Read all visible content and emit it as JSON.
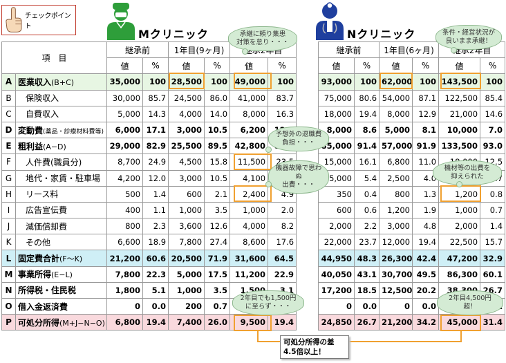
{
  "checkpoint": {
    "label": "チェックポイント"
  },
  "clinics": {
    "m": {
      "title": "Mクリニック"
    },
    "n": {
      "title": "Nクリニック"
    }
  },
  "table": {
    "item_header": "項　目",
    "period_headers": [
      "継承前",
      "1年目(9ヶ月)",
      "継承2年目"
    ],
    "n_period_headers": [
      "継承前",
      "1年目(6ヶ月)",
      "継承2年目"
    ],
    "sub_headers": [
      "値",
      "%"
    ],
    "rows": [
      {
        "letter": "A",
        "label": "医業収入",
        "suffix": "(B+C)",
        "m": [
          "35,000",
          "100",
          "28,500",
          "100",
          "49,000",
          "100"
        ],
        "n": [
          "93,000",
          "100",
          "62,000",
          "100",
          "143,500",
          "100"
        ]
      },
      {
        "letter": "B",
        "label": "保険収入",
        "suffix": "",
        "m": [
          "30,000",
          "85.7",
          "24,500",
          "86.0",
          "41,000",
          "83.7"
        ],
        "n": [
          "75,000",
          "80.6",
          "54,000",
          "87.1",
          "122,500",
          "85.4"
        ]
      },
      {
        "letter": "C",
        "label": "自費収入",
        "suffix": "",
        "m": [
          "5,000",
          "14.3",
          "4,000",
          "14.0",
          "8,000",
          "16.3"
        ],
        "n": [
          "18,000",
          "19.4",
          "8,000",
          "12.9",
          "21,000",
          "14.6"
        ]
      },
      {
        "letter": "D",
        "label": "変動費",
        "suffix": "(薬品・診療材料費等)",
        "m": [
          "6,000",
          "17.1",
          "3,000",
          "10.5",
          "6,200",
          "12.6"
        ],
        "n": [
          "8,000",
          "8.6",
          "5,000",
          "8.1",
          "10,000",
          "7.0"
        ]
      },
      {
        "letter": "E",
        "label": "粗利益",
        "suffix": "(A−D)",
        "m": [
          "29,000",
          "82.9",
          "25,500",
          "89.5",
          "42,800",
          "87.3"
        ],
        "n": [
          "85,000",
          "91.4",
          "57,000",
          "91.9",
          "133,500",
          "93.0"
        ]
      },
      {
        "letter": "F",
        "label": "人件費(職員分)",
        "suffix": "",
        "m": [
          "8,700",
          "24.9",
          "4,500",
          "15.8",
          "11,500",
          "23.5"
        ],
        "n": [
          "15,000",
          "16.1",
          "6,800",
          "11.0",
          "18,000",
          "12.5"
        ]
      },
      {
        "letter": "G",
        "label": "地代・家賃・駐車場",
        "suffix": "",
        "m": [
          "4,200",
          "12.0",
          "3,000",
          "10.5",
          "4,100",
          "8.4"
        ],
        "n": [
          "5,000",
          "5.4",
          "2,500",
          "4.0",
          "2,500",
          "1.7"
        ]
      },
      {
        "letter": "H",
        "label": "リース料",
        "suffix": "",
        "m": [
          "500",
          "1.4",
          "600",
          "2.1",
          "2,400",
          "4.9"
        ],
        "n": [
          "350",
          "0.4",
          "800",
          "1.3",
          "1,200",
          "0.8"
        ]
      },
      {
        "letter": "I",
        "label": "広告宣伝費",
        "suffix": "",
        "m": [
          "400",
          "1.1",
          "1,000",
          "3.5",
          "1,000",
          "2.0"
        ],
        "n": [
          "600",
          "0.6",
          "1,200",
          "1.9",
          "1,000",
          "0.7"
        ]
      },
      {
        "letter": "J",
        "label": "減価償却費",
        "suffix": "",
        "m": [
          "800",
          "2.3",
          "3,600",
          "12.6",
          "4,000",
          "8.2"
        ],
        "n": [
          "2,000",
          "2.2",
          "3,000",
          "4.8",
          "2,000",
          "1.4"
        ]
      },
      {
        "letter": "K",
        "label": "その他",
        "suffix": "",
        "m": [
          "6,600",
          "18.9",
          "7,800",
          "27.4",
          "8,600",
          "17.6"
        ],
        "n": [
          "22,000",
          "23.7",
          "12,000",
          "19.4",
          "22,500",
          "15.7"
        ]
      },
      {
        "letter": "L",
        "label": "固定費合計",
        "suffix": "(F〜K)",
        "m": [
          "21,200",
          "60.6",
          "20,500",
          "71.9",
          "31,600",
          "64.5"
        ],
        "n": [
          "44,950",
          "48.3",
          "26,300",
          "42.4",
          "47,200",
          "32.9"
        ]
      },
      {
        "letter": "M",
        "label": "事業所得",
        "suffix": "(E−L)",
        "m": [
          "7,800",
          "22.3",
          "5,000",
          "17.5",
          "11,200",
          "22.9"
        ],
        "n": [
          "40,050",
          "43.1",
          "30,700",
          "49.5",
          "86,300",
          "60.1"
        ]
      },
      {
        "letter": "N",
        "label": "所得税・住民税",
        "suffix": "",
        "m": [
          "1,800",
          "5.1",
          "1,000",
          "3.5",
          "1,500",
          "3.1"
        ],
        "n": [
          "17,200",
          "18.5",
          "12,500",
          "20.2",
          "38,300",
          "26.7"
        ]
      },
      {
        "letter": "O",
        "label": "借入金返済費",
        "suffix": "",
        "m": [
          "0",
          "0.0",
          "200",
          "0.7",
          "200",
          "0.4"
        ],
        "n": [
          "0",
          "0.0",
          "0",
          "0.0",
          "3,000",
          "2.1"
        ]
      },
      {
        "letter": "P",
        "label": "可処分所得",
        "suffix": "(M+J−N−O)",
        "m": [
          "6,800",
          "19.4",
          "7,400",
          "26.0",
          "9,500",
          "19.4"
        ],
        "n": [
          "24,850",
          "26.7",
          "21,200",
          "34.2",
          "45,000",
          "31.4"
        ]
      }
    ]
  },
  "callouts": {
    "m_top": "承継に頼り集患\n対策を怠り・・・",
    "n_top": "条件・経営状況が\n良いまま承継！",
    "m_staff": "予想外の退職費\n負担・・・",
    "m_equipment": "機器故障で思わぬ\n出費・・・",
    "n_equipment": "機材等の出費を\n抑えられた",
    "m_income": "2年目でも1,500円\nに至らず・・・",
    "n_income": "2年目4,500円超！"
  },
  "conclusion": "可処分所得の差\n4.5倍以上！",
  "colors": {
    "highlight": "#f0a030",
    "row_a": "#e7f6e3",
    "row_l": "#cfeff6",
    "row_p": "#f9d9dd",
    "bubble": "#d4ebd4",
    "m_doctor": "#2e9e3a",
    "n_doctor": "#1f3f9e"
  }
}
